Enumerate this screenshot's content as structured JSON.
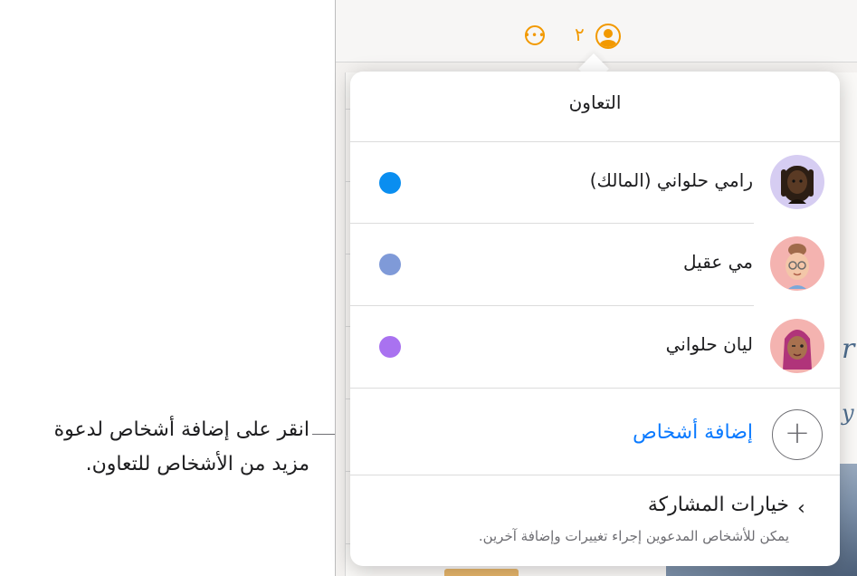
{
  "callout": {
    "line1": "انقر على إضافة أشخاص لدعوة",
    "line2": "مزيد من الأشخاص للتعاون."
  },
  "toolbar": {
    "more_icon": "ellipsis-circle-icon",
    "collaborator_count": "٢",
    "collaborate_icon": "person-circle-icon",
    "accent_color": "#f29900"
  },
  "popover": {
    "title": "التعاون",
    "participants": [
      {
        "name": "رامي حلواني (المالك)",
        "avatar_icon": "memoji-avatar-icon",
        "color": "#0a8ef0"
      },
      {
        "name": "مي عقيل",
        "avatar_icon": "memoji-avatar-icon",
        "color": "#7f9ad8"
      },
      {
        "name": "ليان حلواني",
        "avatar_icon": "memoji-avatar-icon",
        "color": "#a972f0"
      }
    ],
    "add_people": {
      "label": "إضافة أشخاص",
      "icon": "plus-circle-icon",
      "color": "#0a7aff"
    },
    "share_options": {
      "title": "خيارات المشاركة",
      "subtitle": "يمكن للأشخاص المدعوين إجراء تغييرات وإضافة آخرين.",
      "icon": "chevron-left-icon"
    }
  }
}
